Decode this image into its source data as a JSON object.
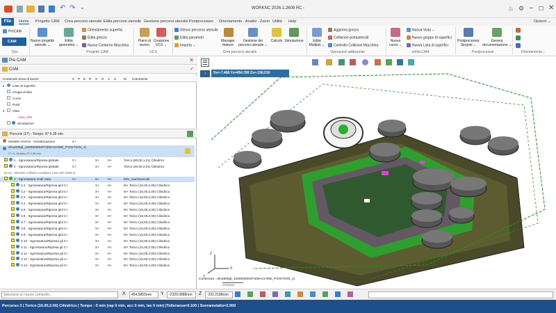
{
  "app": {
    "title": "WORKNC 2026.1.2608 RC -",
    "options_label": "Opzioni ⌄"
  },
  "menu": {
    "file": "File",
    "tabs": [
      "Home",
      "Progetto CAM",
      "Crea percorsi utensile",
      "Edita percorsi utensile",
      "Gestione percorsi utensile",
      "Postprocessor",
      "Orientamento - Analisi - Zoom",
      "Utilità",
      "Help"
    ]
  },
  "ribbon": {
    "precam": "PreCAM",
    "cam": "CAM",
    "nuovo_progetto": "Nuovo progetto\nutensile ⌄",
    "edita_geometria": "Edita\ngeometria ⌄",
    "orientamento_superfici": "Orientamento superfici",
    "edita_grezzo": "Edita grezzo",
    "nuovo_contorno": "Nuovo Contorno Macchina",
    "piano_lavoro": "Piano di\nlavoro",
    "creazione_ucs": "Creazione\nUCS ⌄",
    "stesso_percorso": "Stesso percorso utensile",
    "edita_parametri": "Edita parametri",
    "importa": "Importa ⌄",
    "manager_feature": "Manager\nfeature",
    "gestione_percorsi": "Gestione dei\npercorsi utensile ⌄",
    "calcolo": "Calcolo",
    "simulazione": "Simulazione",
    "edita_multipli": "Edita\nMultiplo ⌄",
    "aggiorna_grezzo": "Aggiorna grezzo",
    "collisione_portautensili": "Collisione portautensili",
    "controllo_collisioni": "Controllo Collisioni Macchina",
    "nuova_curva": "Nuova\ncurva ⌄",
    "nuova_vista": "Nuova Vista ⌄",
    "nuovo_gruppo": "Nuovo gruppo di superfici",
    "nuova_lista": "Nuova Lista di superfici",
    "postprocessor_singolo": "Postprocessor\nSingolo ⌄",
    "genera_documentazione": "Genera\ndocumentazione ⌄",
    "groups": [
      "Tipo",
      "Progetto CAM",
      "UCS",
      "Crea percorsi utensile",
      "Operazioni addizionali",
      "entità CAM",
      "Postprocessor",
      "Orientamento..."
    ]
  },
  "left": {
    "header1": "Pre CAM",
    "header2": "CAM",
    "columns": [
      "Contenuto Zona di lavoro",
      "C",
      "P",
      "E",
      "R",
      "S",
      "H",
      "A",
      "S",
      "M",
      "Comments"
    ],
    "tree_top": [
      "Liste di superfici",
      "Gruppi di liste",
      "Curve",
      "Punti",
      "Viste",
      "View_000",
      "Simulazioni"
    ],
    "percorsi": "Percorsi (17) - Tempo: 47 h 28 min",
    "modello": "Modello Grezzo - Inizializzazione",
    "modello_c": "C+",
    "machine_row": "dmu600gl_126000000073(MACHINE_POSITION_1)",
    "machine_sub": "C+ H- Durata: 47 h 28 min",
    "rows": [
      {
        "label": "1 - Sgrossatura/Ripresa globale",
        "c": "C+",
        "s": "S+",
        "h": "H+",
        "comment": "Torico (80,00,1,01) Cilindrico"
      },
      {
        "label": "2 - Sgrossatura/Ripresa globale",
        "c": "C+",
        "s": "S+",
        "h": "H+",
        "comment": "Torico (40,00,2,01) Cilindrico"
      },
      {
        "label": "M.xxx - Machine Collision Avoidance (new with 2026.1)",
        "c": "",
        "s": "",
        "h": "",
        "comment": ""
      },
      {
        "label": "3 - Sgrossatura multi vista",
        "c": "C+",
        "s": "S+",
        "h": "H+",
        "comment": "/MV_machineColli"
      },
      {
        "label": "3.1 - Sgrossatura/Ripresa glol C+",
        "c": "",
        "s": "S+",
        "h": "H+",
        "comment": "M+ Torico (16,00,2,00) Cilindrico"
      },
      {
        "label": "3.2 - Sgrossatura/Ripresa glol C+",
        "c": "",
        "s": "S+",
        "h": "H+",
        "comment": "M+ Torico (16,00,2,00) Cilindrico"
      },
      {
        "label": "3.3 - Sgrossatura/Ripresa glol C+",
        "c": "",
        "s": "S+",
        "h": "H+",
        "comment": "M+ Torico (16,00,2,00) Cilindrico"
      },
      {
        "label": "3.4 - Sgrossatura/Ripresa glol C+",
        "c": "",
        "s": "S+",
        "h": "H+",
        "comment": "M+ Torico (16,00,2,00) Cilindrico"
      },
      {
        "label": "3.5 - Sgrossatura/Ripresa glol C+",
        "c": "",
        "s": "S+",
        "h": "H+",
        "comment": "M+ Torico (16,00,2,00) Cilindrico"
      },
      {
        "label": "3.6 - Sgrossatura/Ripresa glol C+",
        "c": "",
        "s": "S+",
        "h": "H+",
        "comment": "M+ Torico (16,00,2,00) Cilindrico"
      },
      {
        "label": "3.7 - Sgrossatura/Ripresa glol C+",
        "c": "",
        "s": "S+",
        "h": "H+",
        "comment": "M+ Torico (16,00,2,00) Cilindrico"
      },
      {
        "label": "3.8 - Sgrossatura/Ripresa glol C+",
        "c": "",
        "s": "S+",
        "h": "H+",
        "comment": "M+ Torico (16,00,2,00) Cilindrico"
      },
      {
        "label": "3.9 - Sgrossatura/Ripresa glol C+",
        "c": "",
        "s": "S+",
        "h": "H+",
        "comment": "M+ Torico (16,00,2,00) Cilindrico"
      },
      {
        "label": "3.10 - Sgrossatura/Ripresa gli C+",
        "c": "",
        "s": "S+",
        "h": "H+",
        "comment": "M+ Torico (16,00,2,00) Cilindrico"
      },
      {
        "label": "3.11 - Sgrossatura/Ripresa gli C+",
        "c": "",
        "s": "S+",
        "h": "H+",
        "comment": "M+ Torico (16,00,2,00) Cilindrico"
      },
      {
        "label": "3.12 - Sgrossatura/Ripresa gli C+",
        "c": "",
        "s": "S+",
        "h": "H+",
        "comment": "M+ Torico (16,00,2,00) Cilindrico"
      },
      {
        "label": "3.13 - Sgrossatura/Ripresa gli C+",
        "c": "",
        "s": "S+",
        "h": "H+",
        "comment": "M+ Torico (16,00,2,00) Cilindrico"
      },
      {
        "label": "3.14 - Sgrossatura/Ripresa gli C+",
        "c": "",
        "s": "S+",
        "h": "H+",
        "comment": "M+ Torico (16,00,2,00) Cilindrico"
      }
    ]
  },
  "viewport": {
    "coords": "Xs=-7.468     Ys=454.789  Zs=-156.016",
    "bottom_label": "Contenuto : dmu600gl_126000000073(MACHINE_POSITION_1)",
    "scale": "200(Refs)"
  },
  "cmd": {
    "placeholder": "Selezione un nuovo comando...",
    "x_label": "X",
    "x_value": "454.5855mm",
    "y_label": "Y",
    "y_value": "-2320.0888mm",
    "z_label": "Z",
    "z_value": "-231.2188mm"
  },
  "status": "Percorso 3 | Torico (16.00,2.00) Cilindrico | Tempo : 0 min (rap 0 min, acc 0 min, lav 0 min) |Tolleranza=0.100 | Sovrametallo=2.000",
  "colors": {
    "accent": "#1f5fa6",
    "status_bg": "#1f4e8c",
    "selected_row": "#c9e0f7"
  }
}
